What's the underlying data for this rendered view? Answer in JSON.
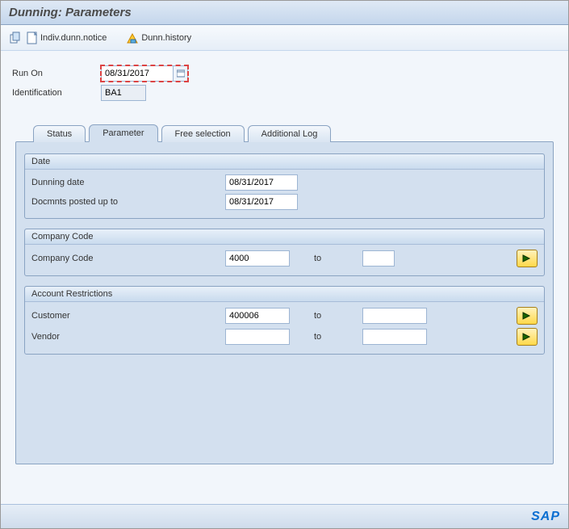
{
  "title": "Dunning: Parameters",
  "toolbar": {
    "copy_icon": "copy-icon",
    "indiv_label": "Indiv.dunn.notice",
    "history_label": "Dunn.history"
  },
  "header": {
    "run_on_label": "Run On",
    "run_on_value": "08/31/2017",
    "identification_label": "Identification",
    "identification_value": "BA1"
  },
  "tabs": [
    "Status",
    "Parameter",
    "Free selection",
    "Additional Log"
  ],
  "groups": {
    "date": {
      "title": "Date",
      "dunning_date_label": "Dunning date",
      "dunning_date_value": "08/31/2017",
      "posted_label": "Docmnts posted up to",
      "posted_value": "08/31/2017"
    },
    "company": {
      "title": "Company Code",
      "cc_label": "Company Code",
      "cc_from": "4000",
      "to_label": "to",
      "cc_to": ""
    },
    "account": {
      "title": "Account Restrictions",
      "customer_label": "Customer",
      "customer_from": "400006",
      "customer_to": "",
      "vendor_label": "Vendor",
      "vendor_from": "",
      "vendor_to": "",
      "to_label": "to"
    }
  },
  "footer": {
    "logo": "SAP"
  }
}
